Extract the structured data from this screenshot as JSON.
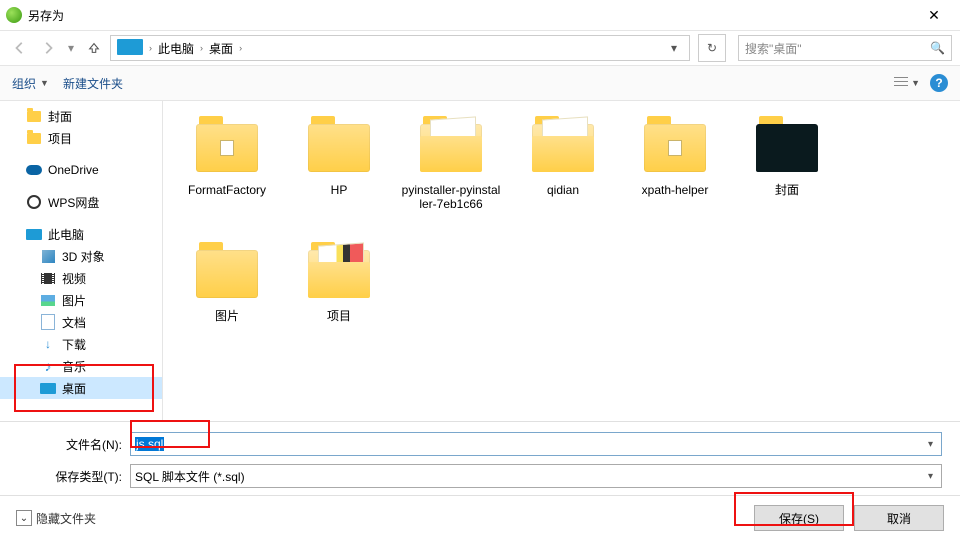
{
  "window": {
    "title": "另存为"
  },
  "nav": {
    "crumb_root": "此电脑",
    "crumb_leaf": "桌面",
    "search_placeholder": "搜索\"桌面\""
  },
  "toolbar": {
    "organize": "组织",
    "new_folder": "新建文件夹"
  },
  "sidebar": {
    "items": [
      {
        "label": "封面",
        "icon": "folder"
      },
      {
        "label": "项目",
        "icon": "folder"
      },
      {
        "label": "OneDrive",
        "icon": "onedrive"
      },
      {
        "label": "WPS网盘",
        "icon": "wps"
      },
      {
        "label": "此电脑",
        "icon": "pc"
      },
      {
        "label": "3D 对象",
        "icon": "cube"
      },
      {
        "label": "视频",
        "icon": "video"
      },
      {
        "label": "图片",
        "icon": "picture"
      },
      {
        "label": "文档",
        "icon": "file"
      },
      {
        "label": "下载",
        "icon": "download"
      },
      {
        "label": "音乐",
        "icon": "music"
      },
      {
        "label": "桌面",
        "icon": "pc",
        "selected": true
      }
    ]
  },
  "grid": {
    "items": [
      {
        "label": "FormatFactory",
        "kind": "folder-mini"
      },
      {
        "label": "HP",
        "kind": "folder"
      },
      {
        "label": "pyinstaller-pyinstaller-7eb1c66",
        "kind": "folder-open"
      },
      {
        "label": "qidian",
        "kind": "folder-open"
      },
      {
        "label": "xpath-helper",
        "kind": "folder-mini"
      },
      {
        "label": "封面",
        "kind": "folder-dark"
      },
      {
        "label": "图片",
        "kind": "folder"
      },
      {
        "label": "项目",
        "kind": "folder-colorful"
      }
    ]
  },
  "form": {
    "filename_label": "文件名(N):",
    "filename_value": "js.sql",
    "type_label": "保存类型(T):",
    "type_value": "SQL 脚本文件 (*.sql)"
  },
  "footer": {
    "hide_folders": "隐藏文件夹",
    "save": "保存(S)",
    "cancel": "取消"
  }
}
